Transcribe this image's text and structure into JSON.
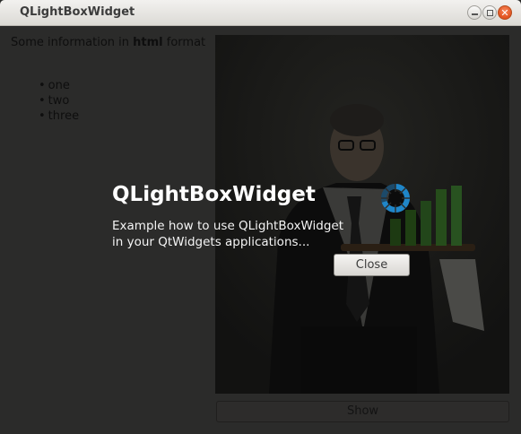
{
  "window": {
    "title": "QLightBoxWidget",
    "controls": {
      "minimize_icon": "minimize-icon",
      "maximize_icon": "maximize-icon",
      "close_icon": "close-icon"
    }
  },
  "content": {
    "info_prefix": "Some information in ",
    "info_bold": "html",
    "info_suffix": " format",
    "list_items": [
      "one",
      "two",
      "three"
    ],
    "show_button_label": "Show"
  },
  "lightbox": {
    "title": "QLightBoxWidget",
    "description_line1": "Example how to use QLightBoxWidget",
    "description_line2": "in your QtWidgets applications...",
    "close_button_label": "Close",
    "spinner_icon": "loading-spinner-icon"
  },
  "colors": {
    "overlay_dim": "#2b2b2a",
    "spinner_blue": "#1f7fbf",
    "lightbox_text": "#ffffff"
  }
}
